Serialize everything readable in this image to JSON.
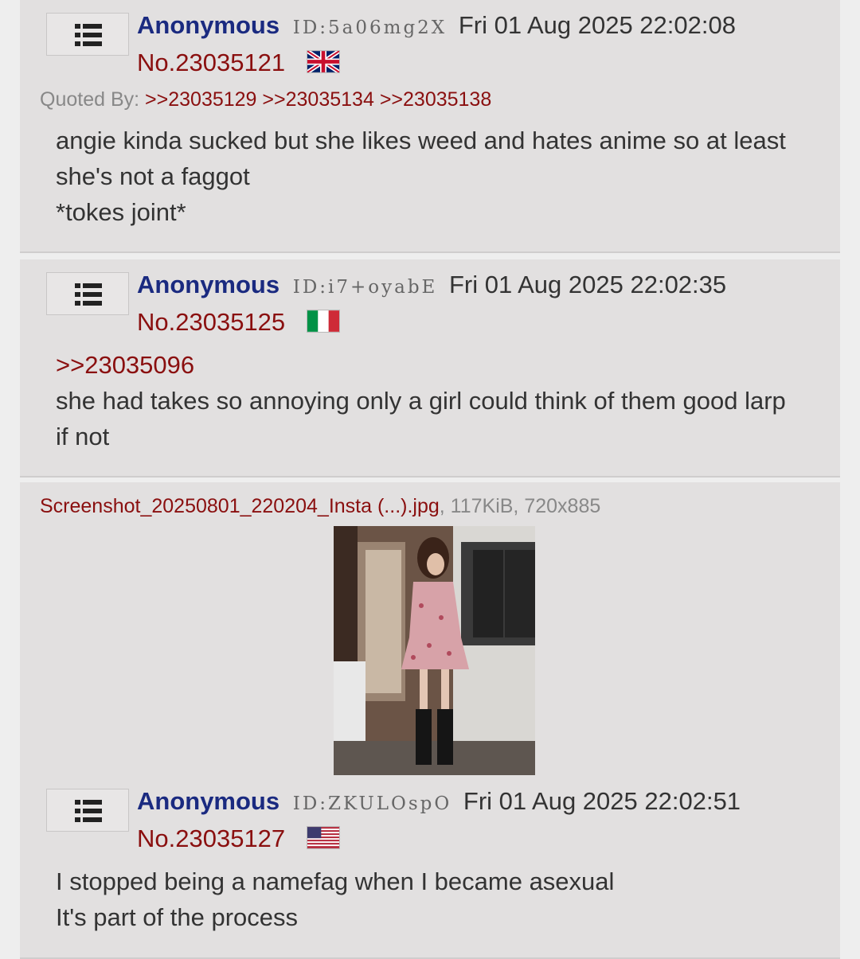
{
  "posts": [
    {
      "name": "Anonymous",
      "id": "ID:5a06mg2X",
      "date": "Fri 01 Aug 2025 22:02:08",
      "number": "No.23035121",
      "flag": "uk-flag",
      "quoted_label": "Quoted By: ",
      "quoted_by": [
        ">>23035129",
        ">>23035134",
        ">>23035138"
      ],
      "lines": [
        "angie kinda sucked but she likes weed and hates anime so at least",
        "she's not a faggot",
        "*tokes joint*"
      ]
    },
    {
      "name": "Anonymous",
      "id": "ID:i7+oyabE",
      "date": "Fri 01 Aug 2025 22:02:35",
      "number": "No.23035125",
      "flag": "italy-flag",
      "reply_link": ">>23035096",
      "lines": [
        "she had takes so annoying only a girl could think of them good larp",
        "if not"
      ]
    },
    {
      "file_name": "Screenshot_20250801_220204_Insta (...).jpg",
      "file_meta": ", 117KiB, 720x885",
      "name": "Anonymous",
      "id": "ID:ZKULOspO",
      "date": "Fri 01 Aug 2025 22:02:51",
      "number": "No.23035127",
      "flag": "us-flag",
      "lines": [
        "I stopped being a namefag when I became asexual",
        "It's part of the process"
      ]
    }
  ],
  "icons": {
    "menu": "list-menu-icon"
  },
  "colors": {
    "post_bg": "#e2e0e0",
    "name": "#1a2a80",
    "link": "#8a0f0f",
    "text": "#333333",
    "meta": "#888888"
  }
}
